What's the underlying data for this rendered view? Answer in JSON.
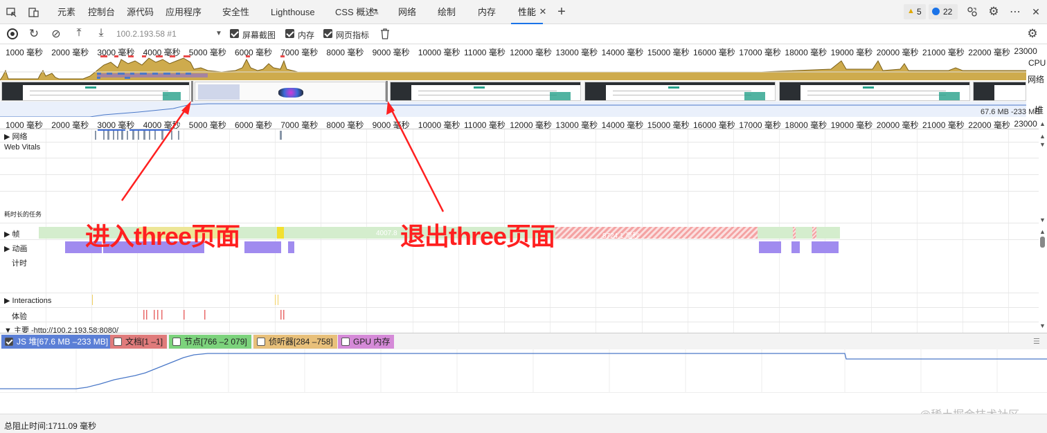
{
  "tabs": [
    {
      "label": "元素"
    },
    {
      "label": "控制台"
    },
    {
      "label": "源代码"
    },
    {
      "label": "应用程序"
    },
    {
      "label": "安全性"
    },
    {
      "label": "Lighthouse"
    },
    {
      "label": "CSS 概述"
    },
    {
      "label": "网络"
    },
    {
      "label": "绘制"
    },
    {
      "label": "内存"
    },
    {
      "label": "性能",
      "active": true
    }
  ],
  "badges": {
    "warnings": "5",
    "messages": "22"
  },
  "toolbar": {
    "profile_select": "100.2.193.58 #1",
    "checkboxes": [
      {
        "label": "屏幕截图",
        "checked": true
      },
      {
        "label": "内存",
        "checked": true
      },
      {
        "label": "网页指标",
        "checked": true
      }
    ]
  },
  "ruler_ticks_top": [
    "1000 毫秒",
    "2000 毫秒",
    "3000 毫秒",
    "4000 毫秒",
    "5000 毫秒",
    "6000 毫秒",
    "7000 毫秒",
    "8000 毫秒",
    "9000 毫秒",
    "10000 毫秒",
    "11000 毫秒",
    "12000 毫秒",
    "13000 毫秒",
    "14000 毫秒",
    "15000 毫秒",
    "16000 毫秒",
    "17000 毫秒",
    "18000 毫秒",
    "19000 毫秒",
    "20000 毫秒",
    "21000 毫秒",
    "22000 毫秒",
    "23000"
  ],
  "overview_labels": {
    "cpu": "CPU",
    "network": "网络",
    "heap": "堆",
    "heap_range": "67.6 MB -233 MB"
  },
  "tracks": {
    "network": "网络",
    "web_vitals": "Web Vitals",
    "long_tasks": "耗时长的任务",
    "frames": "帧",
    "frame_text_1": "4007.8",
    "frame_text_2": "8724.1 毫秒",
    "animations": "动画",
    "timings": "计时",
    "interactions": "Interactions",
    "experience": "体验",
    "main": "主要 -http://100.2.193.58:8080/"
  },
  "annotations": {
    "enter": "进入three页面",
    "exit": "退出three页面"
  },
  "memory_counters": [
    {
      "label": "JS 堆[67.6 MB –233 MB]",
      "checked": true,
      "color": "#5b7fd6"
    },
    {
      "label": "文档[1 –1]",
      "checked": false,
      "color": "#e07b7b"
    },
    {
      "label": "节点[766 –2 079]",
      "checked": false,
      "color": "#7cd37c"
    },
    {
      "label": "侦听器[284 –758]",
      "checked": false,
      "color": "#e8c07a"
    },
    {
      "label": "GPU 内存",
      "checked": false,
      "color": "#d58ad8"
    }
  ],
  "status": {
    "total_blocking": "总阻止时间:1711.09 毫秒"
  },
  "watermark": "@稀土掘金技术社区"
}
